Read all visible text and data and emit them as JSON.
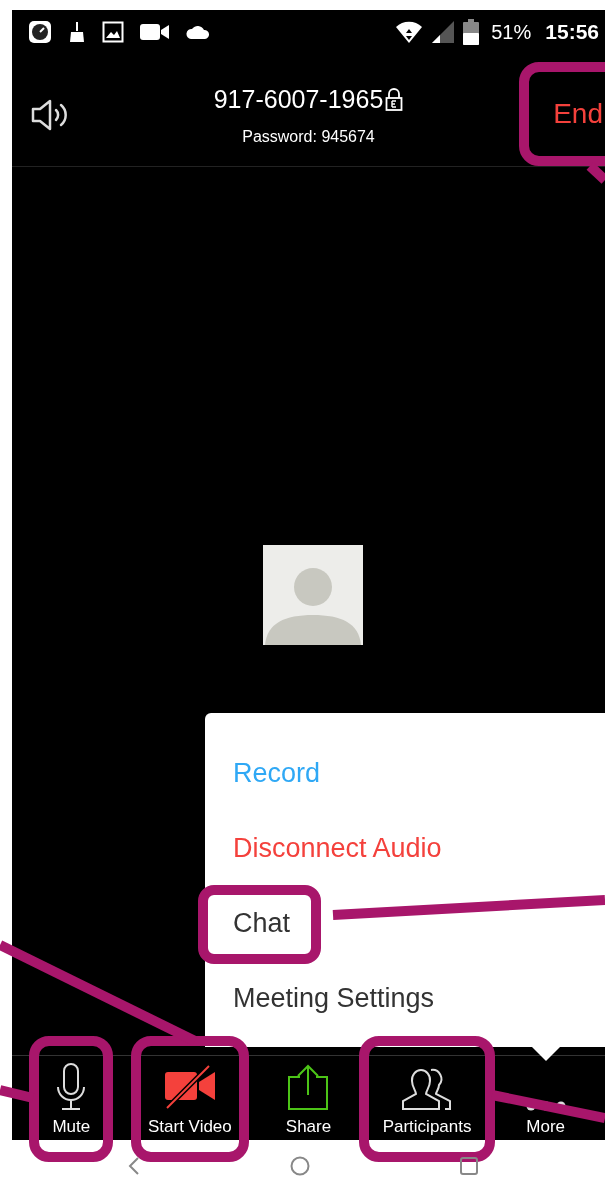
{
  "status_bar": {
    "battery": "51%",
    "time": "15:56"
  },
  "meeting": {
    "id": "917-6007-1965",
    "password": "Password: 945674",
    "end_label": "End",
    "end_callout": true
  },
  "menu": {
    "items": [
      {
        "label": "Record",
        "kind": "accent",
        "callout": false
      },
      {
        "label": "Disconnect Audio",
        "kind": "danger",
        "callout": false
      },
      {
        "label": "Chat",
        "kind": "normal",
        "callout": true
      },
      {
        "label": "Meeting Settings",
        "kind": "normal",
        "callout": false
      }
    ]
  },
  "toolbar": [
    {
      "label": "Mute",
      "kind": "mic",
      "callout": true,
      "expanded": false
    },
    {
      "label": "Start Video",
      "kind": "video-off",
      "callout": true,
      "expanded": false
    },
    {
      "label": "Share",
      "kind": "share",
      "callout": false,
      "expanded": false
    },
    {
      "label": "Participants",
      "kind": "participants",
      "callout": true,
      "expanded": false
    },
    {
      "label": "More",
      "kind": "more",
      "callout": false,
      "expanded": true
    }
  ]
}
